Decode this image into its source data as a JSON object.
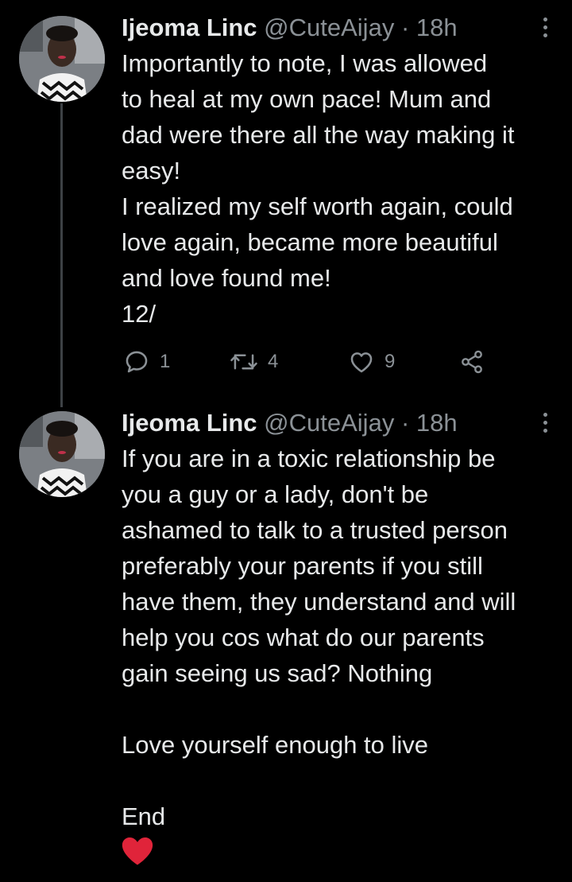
{
  "colors": {
    "background": "#000000",
    "text": "#e7e9ea",
    "secondary_text": "#8b9196",
    "thread_line": "#3d4145",
    "heart_emoji": "#e0243a"
  },
  "tweets": [
    {
      "author_name": "Ijeoma Linc",
      "handle": "@CuteAijay",
      "separator": "·",
      "time": "18h",
      "lines": [
        "Importantly to note, I was allowed",
        "to heal at my own pace! Mum and",
        "dad were there all the way making it",
        "easy!",
        "I realized my self worth again, could",
        "love again, became more beautiful",
        "and love found me!",
        "12/"
      ],
      "reply_count": "1",
      "retweet_count": "4",
      "like_count": "9",
      "icons": [
        "reply-icon",
        "retweet-icon",
        "like-icon",
        "share-icon",
        "more-options-icon"
      ]
    },
    {
      "author_name": "Ijeoma Linc",
      "handle": "@CuteAijay",
      "separator": "·",
      "time": "18h",
      "lines": [
        "If you are in a toxic relationship be",
        "you a guy or a lady, don't be",
        "ashamed to talk to a trusted person",
        "preferably your parents if you still",
        "have them, they understand and will",
        "help you cos what do our parents",
        "gain seeing us sad? Nothing",
        "",
        "Love yourself enough to live",
        "",
        "End"
      ],
      "emoji": "red-heart-emoji",
      "icons": [
        "more-options-icon"
      ]
    }
  ]
}
